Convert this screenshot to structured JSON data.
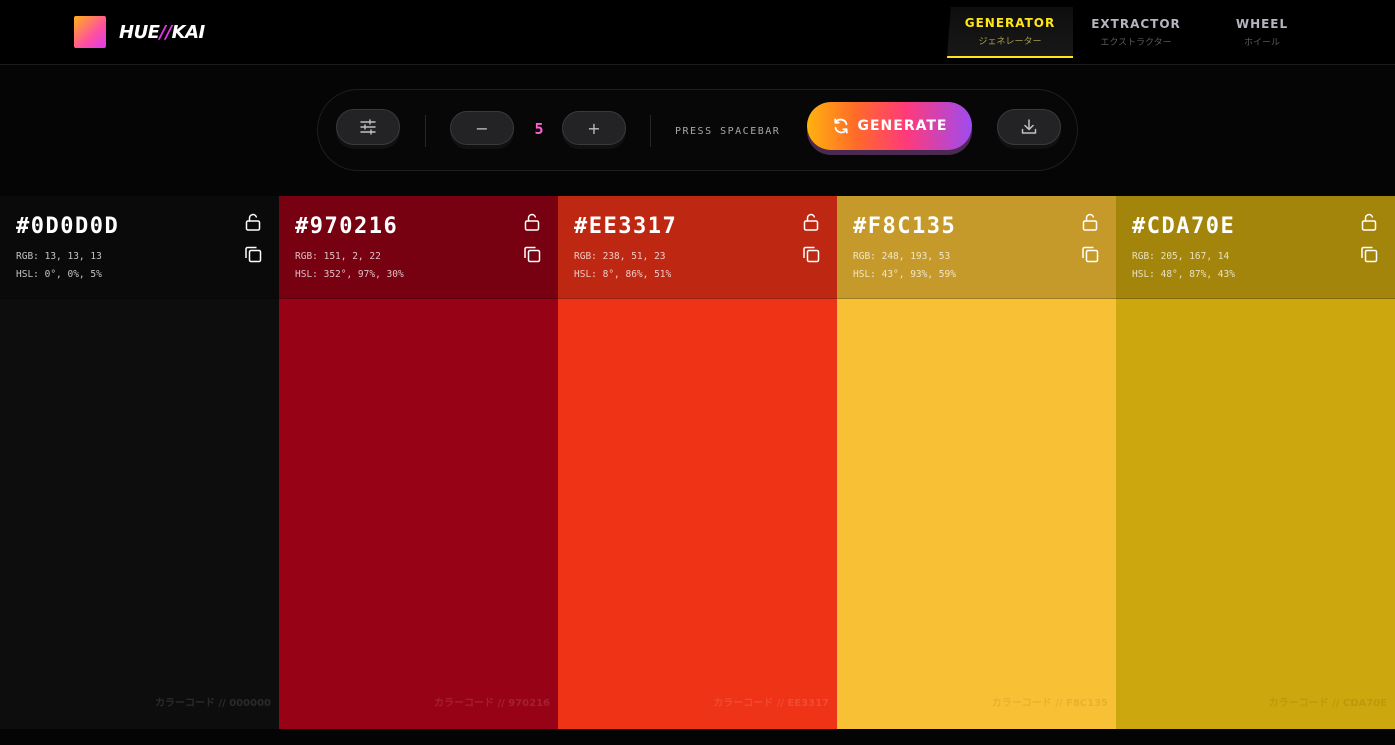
{
  "brand": {
    "name_a": "HUE",
    "name_sep": "//",
    "name_b": "KAI"
  },
  "nav": [
    {
      "label": "GENERATOR",
      "sub": "ジェネレーター",
      "active": true
    },
    {
      "label": "EXTRACTOR",
      "sub": "エクストラクター",
      "active": false
    },
    {
      "label": "WHEEL",
      "sub": "ホイール",
      "active": false
    }
  ],
  "toolbar": {
    "count": "5",
    "hint": "PRESS SPACEBAR",
    "generate_label": "GENERATE",
    "minus": "−",
    "plus": "+"
  },
  "colors": [
    {
      "hex": "#0D0D0D",
      "rgb": "RGB: 13, 13, 13",
      "hsl": "HSL: 0°, 0%, 5%",
      "code": "カラーコード // 000000",
      "swatch": "#0d0d0d"
    },
    {
      "hex": "#970216",
      "rgb": "RGB: 151, 2, 22",
      "hsl": "HSL: 352°, 97%, 30%",
      "code": "カラーコード // 970216",
      "swatch": "#970216"
    },
    {
      "hex": "#EE3317",
      "rgb": "RGB: 238, 51, 23",
      "hsl": "HSL: 8°, 86%, 51%",
      "code": "カラーコード // EE3317",
      "swatch": "#ee3317"
    },
    {
      "hex": "#F8C135",
      "rgb": "RGB: 248, 193, 53",
      "hsl": "HSL: 43°, 93%, 59%",
      "code": "カラーコード // F8C135",
      "swatch": "#f8c135"
    },
    {
      "hex": "#CDA70E",
      "rgb": "RGB: 205, 167, 14",
      "hsl": "HSL: 48°, 87%, 43%",
      "code": "カラーコード // CDA70E",
      "swatch": "#cda70e"
    }
  ],
  "icons": {
    "settings": "sliders-icon",
    "download": "download-icon",
    "refresh": "refresh-icon",
    "lock": "unlock-icon",
    "copy": "copy-icon"
  },
  "accent": {
    "tab_active": "#ffe51a",
    "count": "#ff5fd0"
  }
}
